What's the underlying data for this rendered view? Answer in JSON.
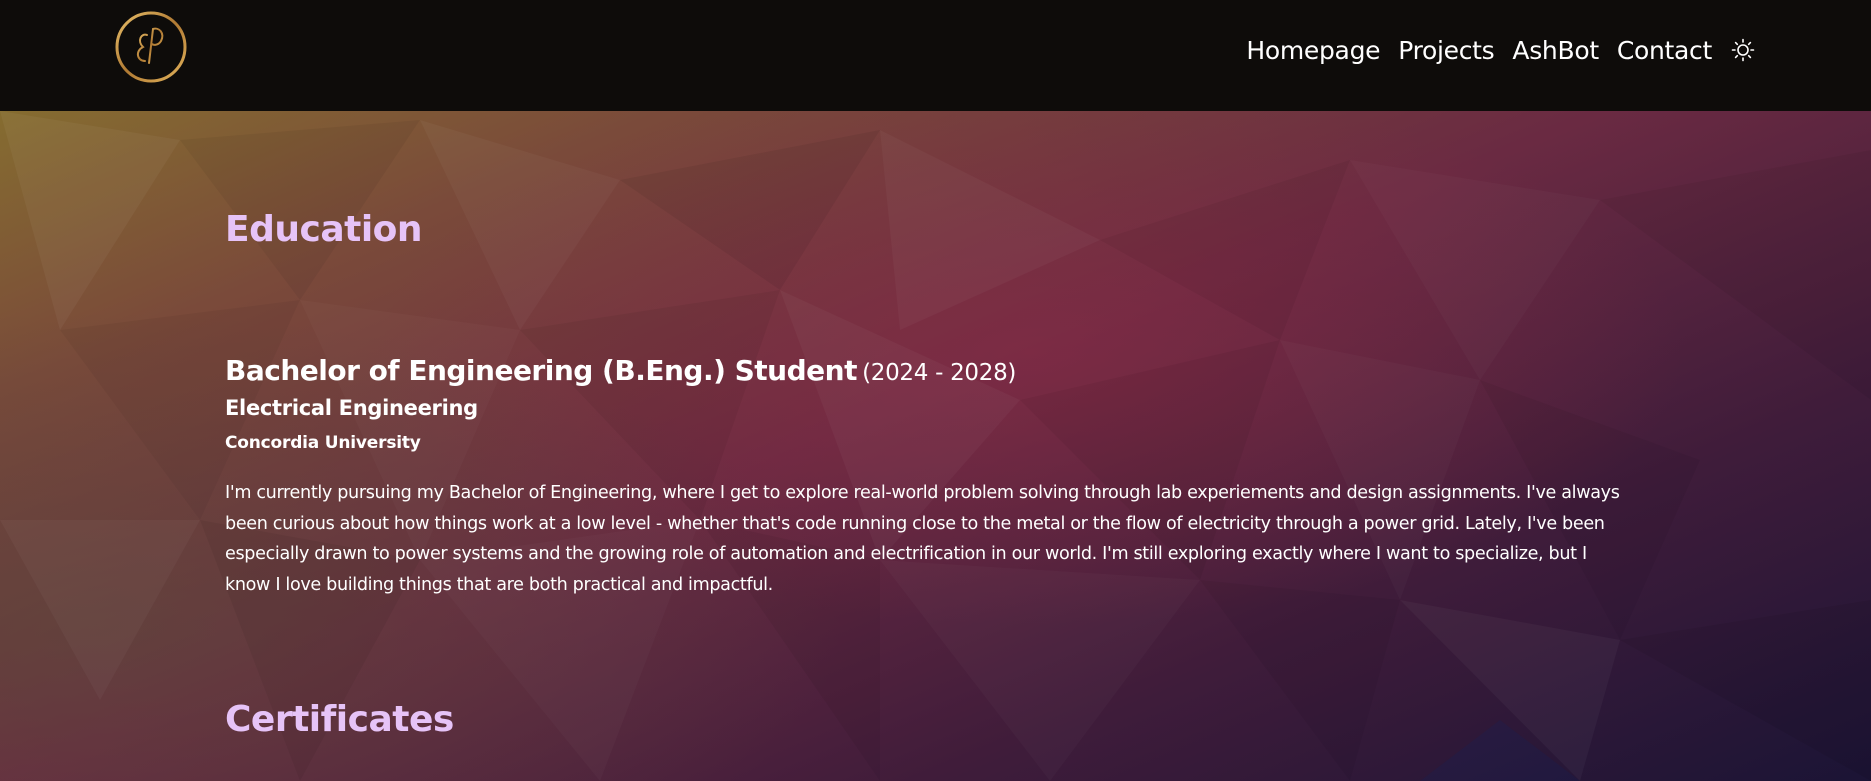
{
  "nav": {
    "logo_alt": "logo",
    "links": [
      "Homepage",
      "Projects",
      "AshBot",
      "Contact"
    ],
    "theme_icon": "sun-icon"
  },
  "education": {
    "title": "Education",
    "degree": "Bachelor of Engineering (B.Eng.) Student",
    "years": "(2024 - 2028)",
    "major": "Electrical Engineering",
    "school": "Concordia University",
    "description": "I'm currently pursuing my Bachelor of Engineering, where I get to explore real-world problem solving through lab experiements and design assignments. I've always been curious about how things work at a low level - whether that's code running close to the metal or the flow of electricity through a power grid. Lately, I've been especially drawn to power systems and the growing role of automation and electrification in our world. I'm still exploring exactly where I want to specialize, but I know I love building things that are both practical and impactful."
  },
  "certificates": {
    "title": "Certificates"
  },
  "colors": {
    "navbar": "#0e0c0a",
    "section_title": "#e6c3f7",
    "logo_gold": "#c9974a"
  }
}
